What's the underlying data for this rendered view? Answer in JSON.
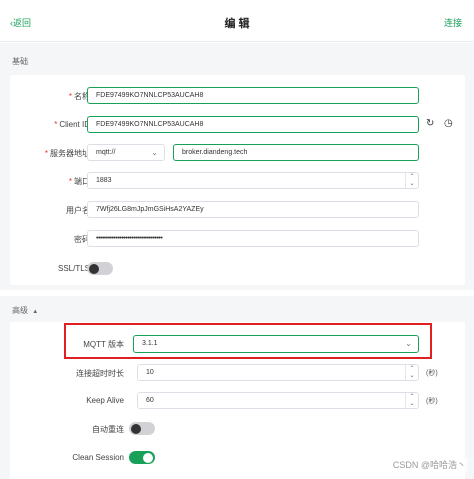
{
  "header": {
    "back_label": "返回",
    "title": "编 辑",
    "connect_label": "连接"
  },
  "basic": {
    "section_title": "基础",
    "name": {
      "label": "名称",
      "value": "FDE97499KO7NNLCP53AUCAH8"
    },
    "client_id": {
      "label": "Client ID",
      "value": "FDE97499KO7NNLCP53AUCAH8"
    },
    "host": {
      "label": "服务器地址",
      "protocol": "mqtt://",
      "value": "broker.diandeng.tech"
    },
    "port": {
      "label": "端口",
      "value": "1883"
    },
    "username": {
      "label": "用户名",
      "value": "7Wfj26LG8mJpJmGSiHsA2YAZEy"
    },
    "password": {
      "label": "密码",
      "value": "••••••••••••••••••••••••••••••••••"
    },
    "ssl": {
      "label": "SSL/TLS",
      "enabled": false
    }
  },
  "advanced": {
    "section_title": "高级",
    "collapse_icon": "▲",
    "mqtt_version": {
      "label": "MQTT 版本",
      "value": "3.1.1"
    },
    "connect_timeout": {
      "label": "连接超时时长",
      "value": "10",
      "unit": "(秒)"
    },
    "keep_alive": {
      "label": "Keep Alive",
      "value": "60",
      "unit": "(秒)"
    },
    "auto_reconnect": {
      "label": "自动重连",
      "enabled": false
    },
    "clean_session": {
      "label": "Clean Session",
      "enabled": true
    }
  },
  "icons": {
    "back": "‹",
    "refresh": "↻",
    "clock": "◷",
    "up": "⌃",
    "down": "⌄",
    "chevron": "⌄"
  },
  "watermark": "CSDN @哈哈浩丶",
  "colors": {
    "accent": "#18a058",
    "highlight": "#e02020",
    "required": "#e03131"
  }
}
